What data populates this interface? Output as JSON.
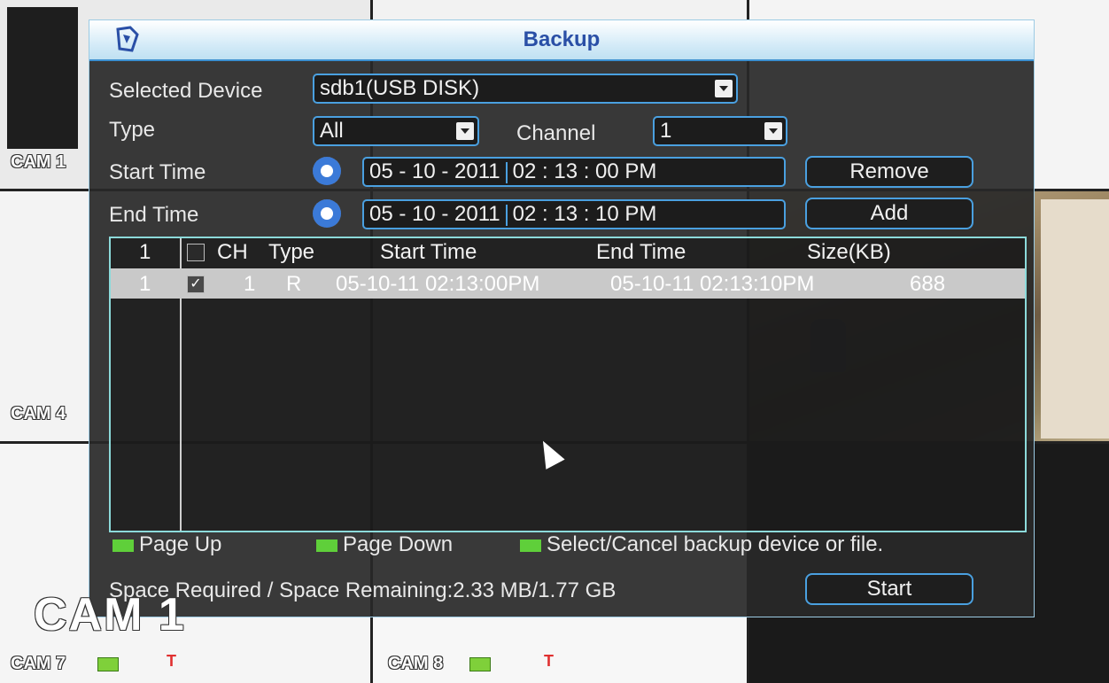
{
  "cameras": {
    "labels": [
      "CAM 1",
      "CAM 4",
      "CAM 7",
      "CAM 8"
    ],
    "overlay_label": "CAM 1",
    "alarm_glyph": "T"
  },
  "dialog": {
    "title": "Backup",
    "selected_device": {
      "label": "Selected Device",
      "value": "sdb1(USB DISK)"
    },
    "type": {
      "label": "Type",
      "value": "All"
    },
    "channel": {
      "label": "Channel",
      "value": "1"
    },
    "start_time": {
      "label": "Start Time",
      "date": "05 - 10 - 2011",
      "time": "02 : 13 : 00  PM"
    },
    "end_time": {
      "label": "End Time",
      "date": "05 - 10 - 2011",
      "time": "02 : 13 : 10  PM"
    },
    "buttons": {
      "remove": "Remove",
      "add": "Add",
      "start": "Start"
    },
    "table": {
      "header": {
        "count": "1",
        "ch": "CH",
        "type": "Type",
        "start": "Start Time",
        "end": "End Time",
        "size": "Size(KB)"
      },
      "rows": [
        {
          "index": "1",
          "checked": true,
          "ch": "1",
          "type": "R",
          "start": "05-10-11 02:13:00PM",
          "end": "05-10-11 02:13:10PM",
          "size": "688"
        }
      ]
    },
    "legend": {
      "page_up": "Page Up",
      "page_down": "Page Down",
      "select_cancel": "Select/Cancel backup device or file."
    },
    "space": "Space Required / Space Remaining:2.33 MB/1.77 GB"
  },
  "colors": {
    "accent": "#4aa0e0",
    "title_text": "#2a4fa6",
    "legend_key": "#5fcf3a"
  }
}
